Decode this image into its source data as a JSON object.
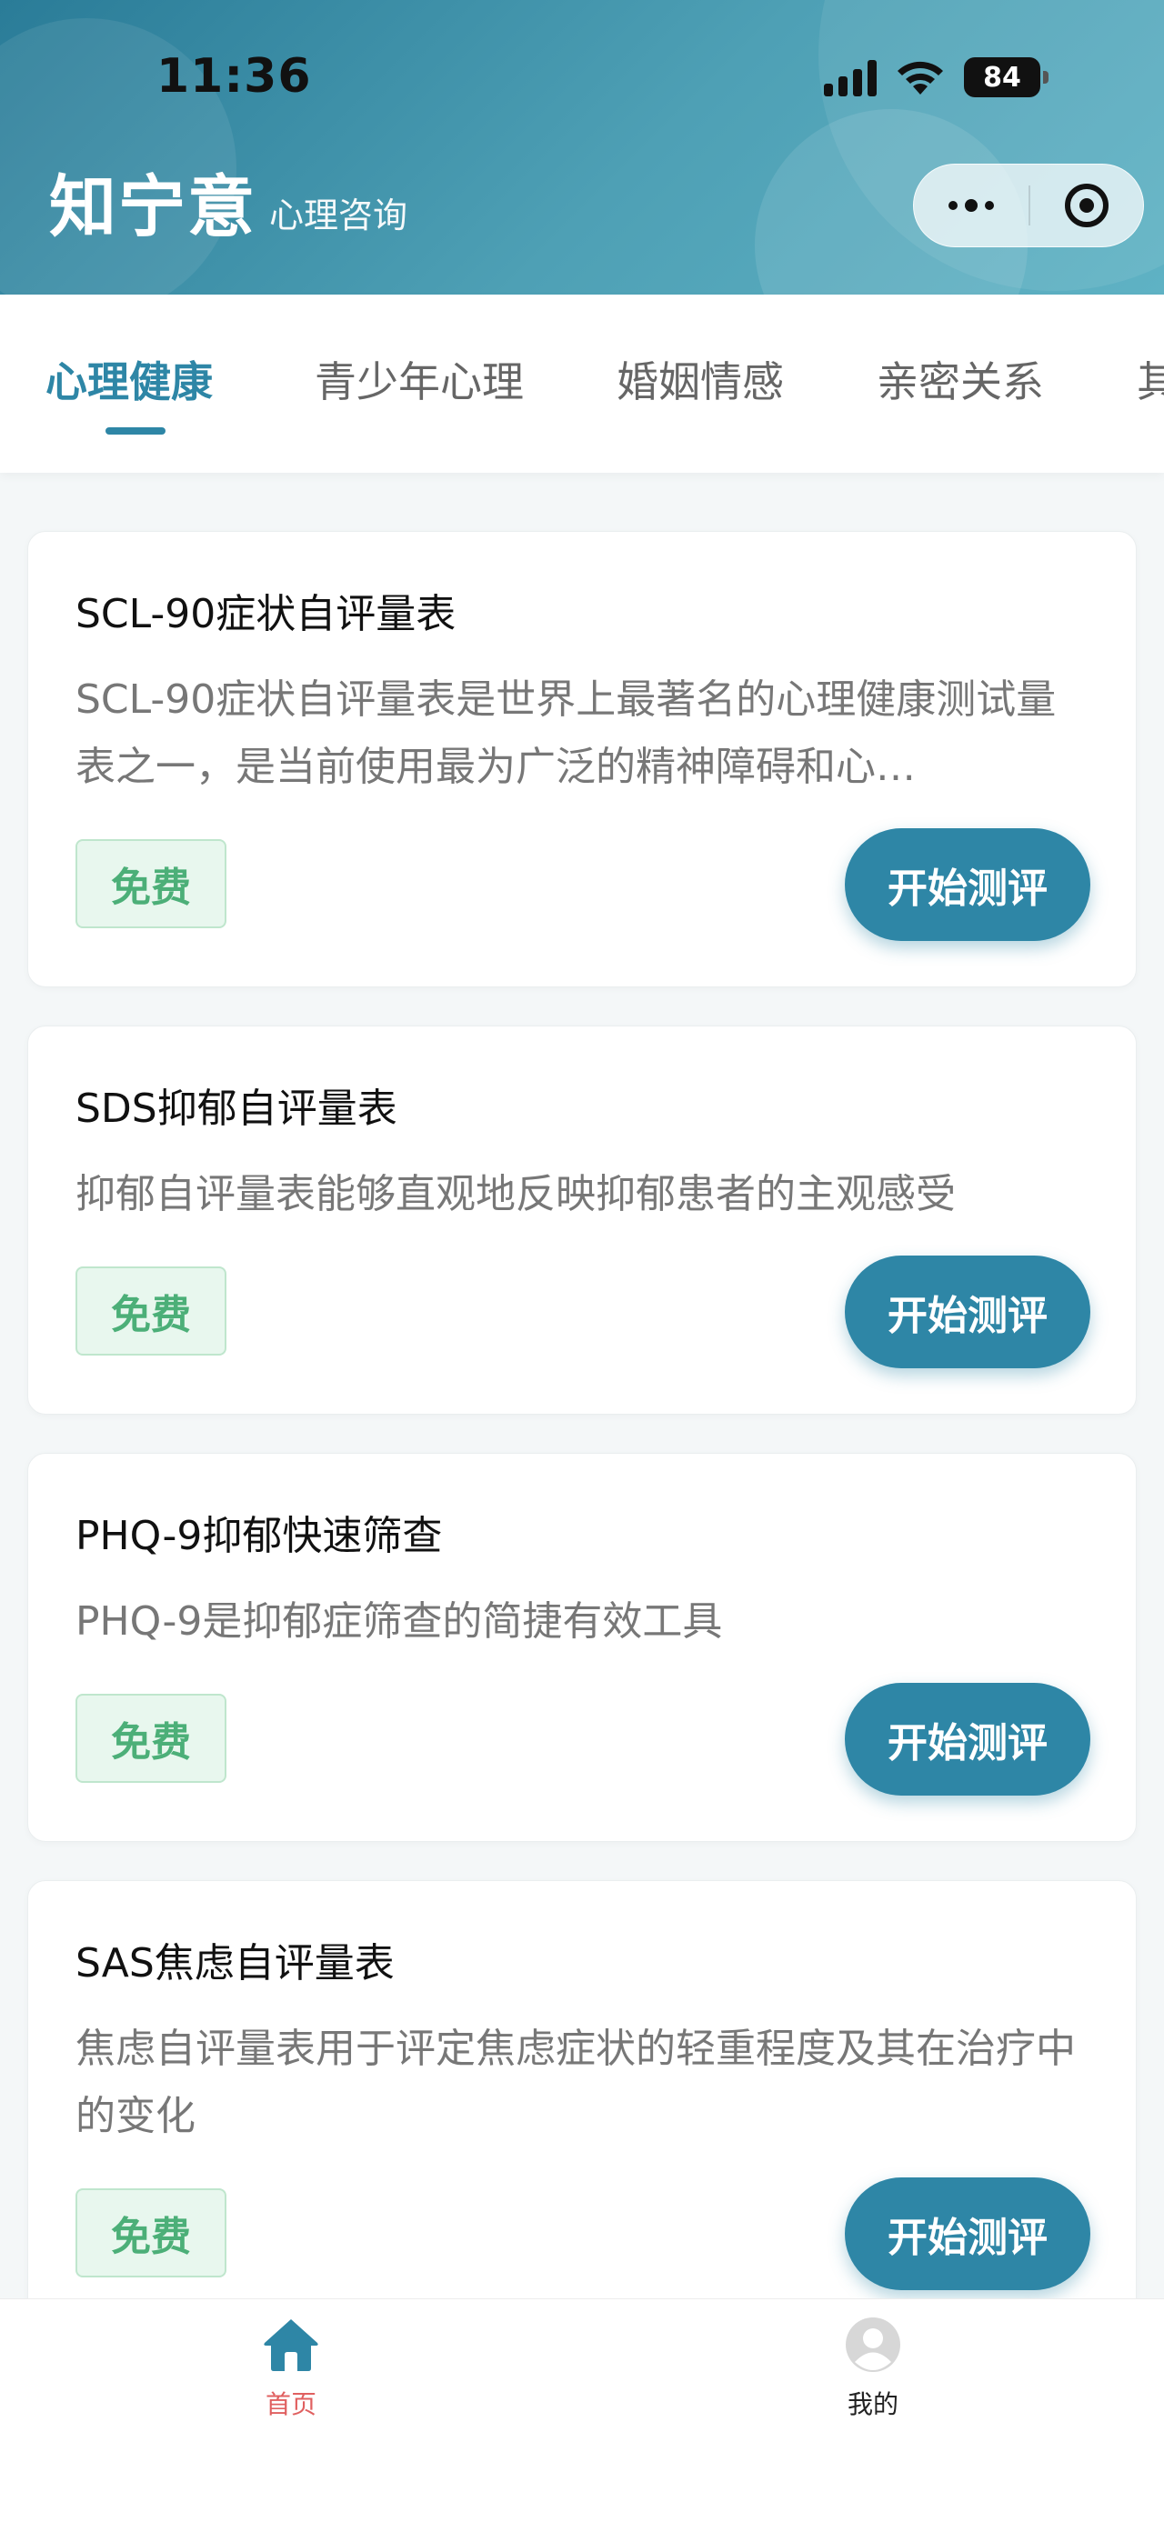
{
  "status_bar": {
    "time": "11:36",
    "battery": "84"
  },
  "header": {
    "title": "知宁意",
    "subtitle": "心理咨询"
  },
  "tabs": [
    {
      "label": "心理健康",
      "active": true
    },
    {
      "label": "青少年心理",
      "active": false
    },
    {
      "label": "婚姻情感",
      "active": false
    },
    {
      "label": "亲密关系",
      "active": false
    },
    {
      "label": "其",
      "active": false
    }
  ],
  "cards": [
    {
      "title": "SCL-90症状自评量表",
      "description": "SCL-90症状自评量表是世界上最著名的心理健康测试量表之一，是当前使用最为广泛的精神障碍和心…",
      "badge": "免费",
      "button": "开始测评"
    },
    {
      "title": "SDS抑郁自评量表",
      "description": "抑郁自评量表能够直观地反映抑郁患者的主观感受",
      "badge": "免费",
      "button": "开始测评"
    },
    {
      "title": "PHQ-9抑郁快速筛查",
      "description": "PHQ-9是抑郁症筛查的简捷有效工具",
      "badge": "免费",
      "button": "开始测评"
    },
    {
      "title": "SAS焦虑自评量表",
      "description": "焦虑自评量表用于评定焦虑症状的轻重程度及其在治疗中的变化",
      "badge": "免费",
      "button": "开始测评"
    }
  ],
  "bottom_nav": [
    {
      "label": "首页",
      "icon": "home-icon",
      "active": true
    },
    {
      "label": "我的",
      "icon": "user-icon",
      "active": false
    }
  ],
  "colors": {
    "primary": "#2e86a6",
    "free_badge_text": "#4caf78",
    "active_nav_label": "#e06060"
  }
}
